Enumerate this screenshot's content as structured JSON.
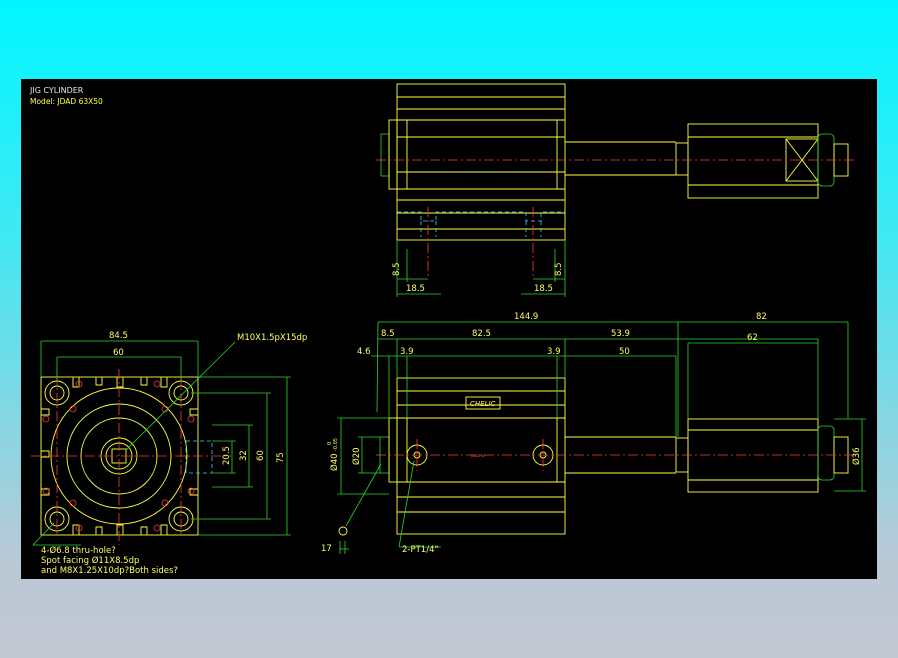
{
  "title_block": {
    "title": "JIG CYLINDER",
    "model": "Model: JDAD 63X50"
  },
  "top_view": {
    "dims": {
      "a": "8.5",
      "b": "18.5",
      "c": "18.5",
      "d": "8.5"
    }
  },
  "front_view": {
    "dims": {
      "width_outer": "84.5",
      "width_inner": "60",
      "height_outer": "75",
      "height_inner": "60",
      "port_height": "32",
      "port_width": "20.5"
    },
    "callout_thread": "M10X1.5pX15dp",
    "notes": [
      "4-Ø6.8 thru-hole?",
      "Spot facing Ø11X8.5dp",
      "and M8X1.25X10dp?Both sides?"
    ]
  },
  "side_view": {
    "dims": {
      "total": "144.9",
      "rod_total": "82",
      "d8_5": "8.5",
      "body": "82.5",
      "d53_9": "53.9",
      "d62": "62",
      "d4_6": "4.6",
      "d3_9a": "3.9",
      "d3_9b": "3.9",
      "d50": "50",
      "bore": "Ø20",
      "rod_dia": "Ø40",
      "rod_tol": "-0.05",
      "rod_zero": "0",
      "end_dia": "Ø36",
      "d17": "17"
    },
    "port_label": "2-PT1/4\"",
    "logo_text": "CHELIC",
    "tiny_label": "JDAD 63"
  },
  "colors": {
    "background_top": "#00f6ff",
    "background_bottom": "#c3c7d2",
    "canvas": "#000000",
    "outline": "#ffff40",
    "dimension": "#2bd62b",
    "centerline": "#ff3a3a",
    "hidden": "#30d8ff"
  }
}
